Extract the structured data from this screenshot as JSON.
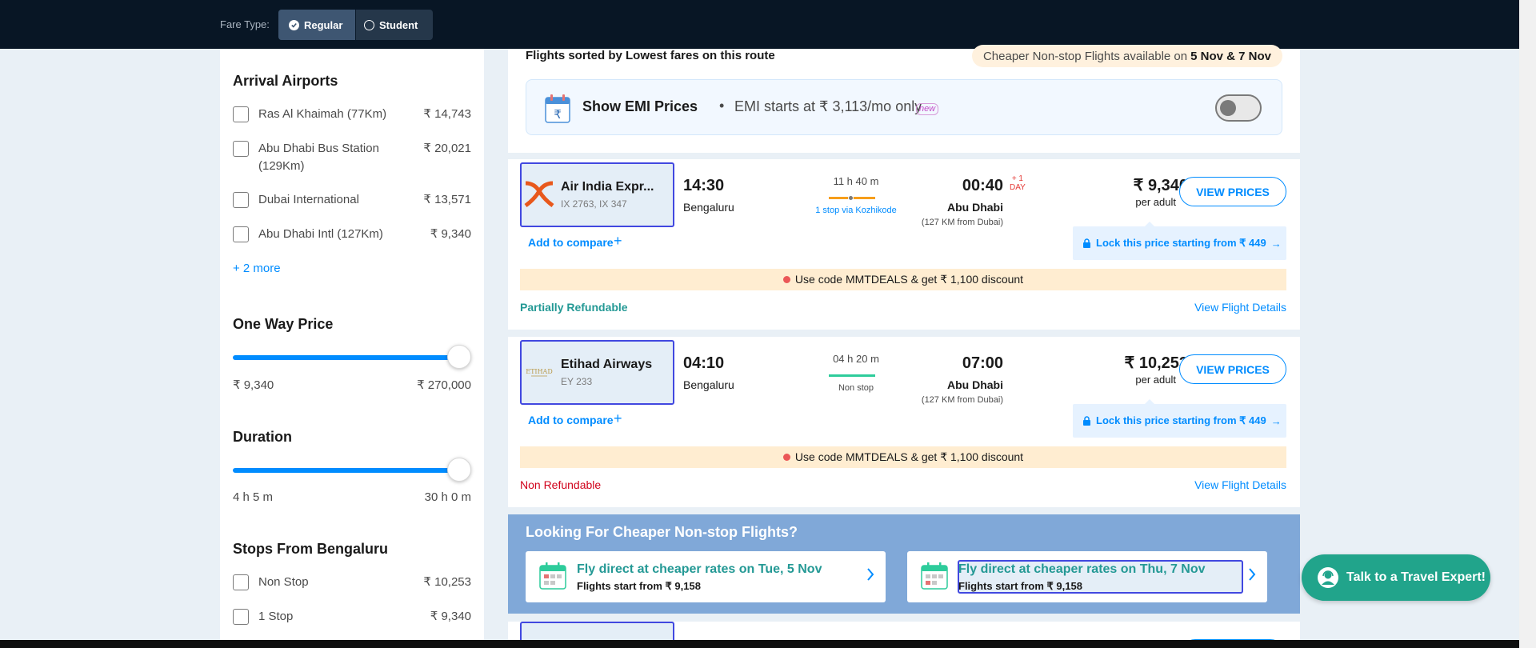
{
  "topbar": {
    "fare_type_label": "Fare Type:",
    "options": [
      {
        "label": "Regular",
        "selected": true
      },
      {
        "label": "Student",
        "selected": false
      }
    ]
  },
  "sidebar": {
    "arrival_airports": {
      "title": "Arrival Airports",
      "items": [
        {
          "name": "Ras Al Khaimah (77Km)",
          "price": "₹ 14,743"
        },
        {
          "name": "Abu Dhabi Bus Station (129Km)",
          "price": "₹ 20,021"
        },
        {
          "name": "Dubai International",
          "price": "₹ 13,571"
        },
        {
          "name": "Abu Dhabi Intl (127Km)",
          "price": "₹ 9,340"
        }
      ],
      "more_link": "+ 2 more"
    },
    "one_way_price": {
      "title": "One Way Price",
      "min": "₹ 9,340",
      "max": "₹ 270,000",
      "slider_fraction": 1.0
    },
    "duration": {
      "title": "Duration",
      "min": "4 h 5 m",
      "max": "30 h 0 m",
      "slider_fraction": 1.0
    },
    "stops": {
      "title": "Stops From Bengaluru",
      "items": [
        {
          "name": "Non Stop",
          "price": "₹ 10,253"
        },
        {
          "name": "1 Stop",
          "price": "₹ 9,340"
        }
      ]
    }
  },
  "results_header": {
    "sort_text": "Flights sorted by Lowest fares on this route",
    "cheaper_prefix": "Cheaper Non-stop Flights available on",
    "cheaper_dates": "5 Nov & 7 Nov"
  },
  "emi": {
    "title": "Show EMI Prices",
    "dot": "•",
    "subtitle": "EMI starts at ₹ 3,113/mo only",
    "badge": "new",
    "enabled": false
  },
  "flights": [
    {
      "airline": "Air India Expr...",
      "flight_no": "IX 2763, IX 347",
      "dep_time": "14:30",
      "dep_city": "Bengaluru",
      "duration": "11 h 40 m",
      "stops": "1 stop via Kozhikode",
      "arr_time": "00:40",
      "plus_day": "+ 1",
      "plus_day_unit": "DAY",
      "arr_city": "Abu Dhabi",
      "arr_note": "(127 KM from Dubai)",
      "price": "₹ 9,340",
      "per_adult": "per adult",
      "view_prices": "VIEW PRICES",
      "lock_text": "Lock this price starting from ₹ 449",
      "compare": "Add to compare",
      "promo": "Use code MMTDEALS & get ₹ 1,100 discount",
      "refund": "Partially Refundable",
      "details": "View Flight Details"
    },
    {
      "airline": "Etihad Airways",
      "flight_no": "EY 233",
      "dep_time": "04:10",
      "dep_city": "Bengaluru",
      "duration": "04 h 20 m",
      "stops": "Non stop",
      "arr_time": "07:00",
      "arr_city": "Abu Dhabi",
      "arr_note": "(127 KM from Dubai)",
      "price": "₹ 10,253",
      "per_adult": "per adult",
      "view_prices": "VIEW PRICES",
      "lock_text": "Lock this price starting from ₹ 449",
      "compare": "Add to compare",
      "promo": "Use code MMTDEALS & get ₹ 1,100 discount",
      "refund": "Non Refundable",
      "details": "View Flight Details"
    }
  ],
  "cheaper_banner": {
    "title": "Looking For Cheaper Non-stop Flights?",
    "cards": [
      {
        "main": "Fly direct at cheaper rates on Tue, 5 Nov",
        "sub": "Flights start from ₹ 9,158"
      },
      {
        "main": "Fly direct at cheaper rates on Thu, 7 Nov",
        "sub": "Flights start from ₹ 9,158"
      }
    ]
  },
  "expert_button": "Talk to a Travel Expert!",
  "colors": {
    "primary": "#008cff",
    "topbar": "#081625",
    "teal": "#249995",
    "banner": "#80a8d8"
  }
}
